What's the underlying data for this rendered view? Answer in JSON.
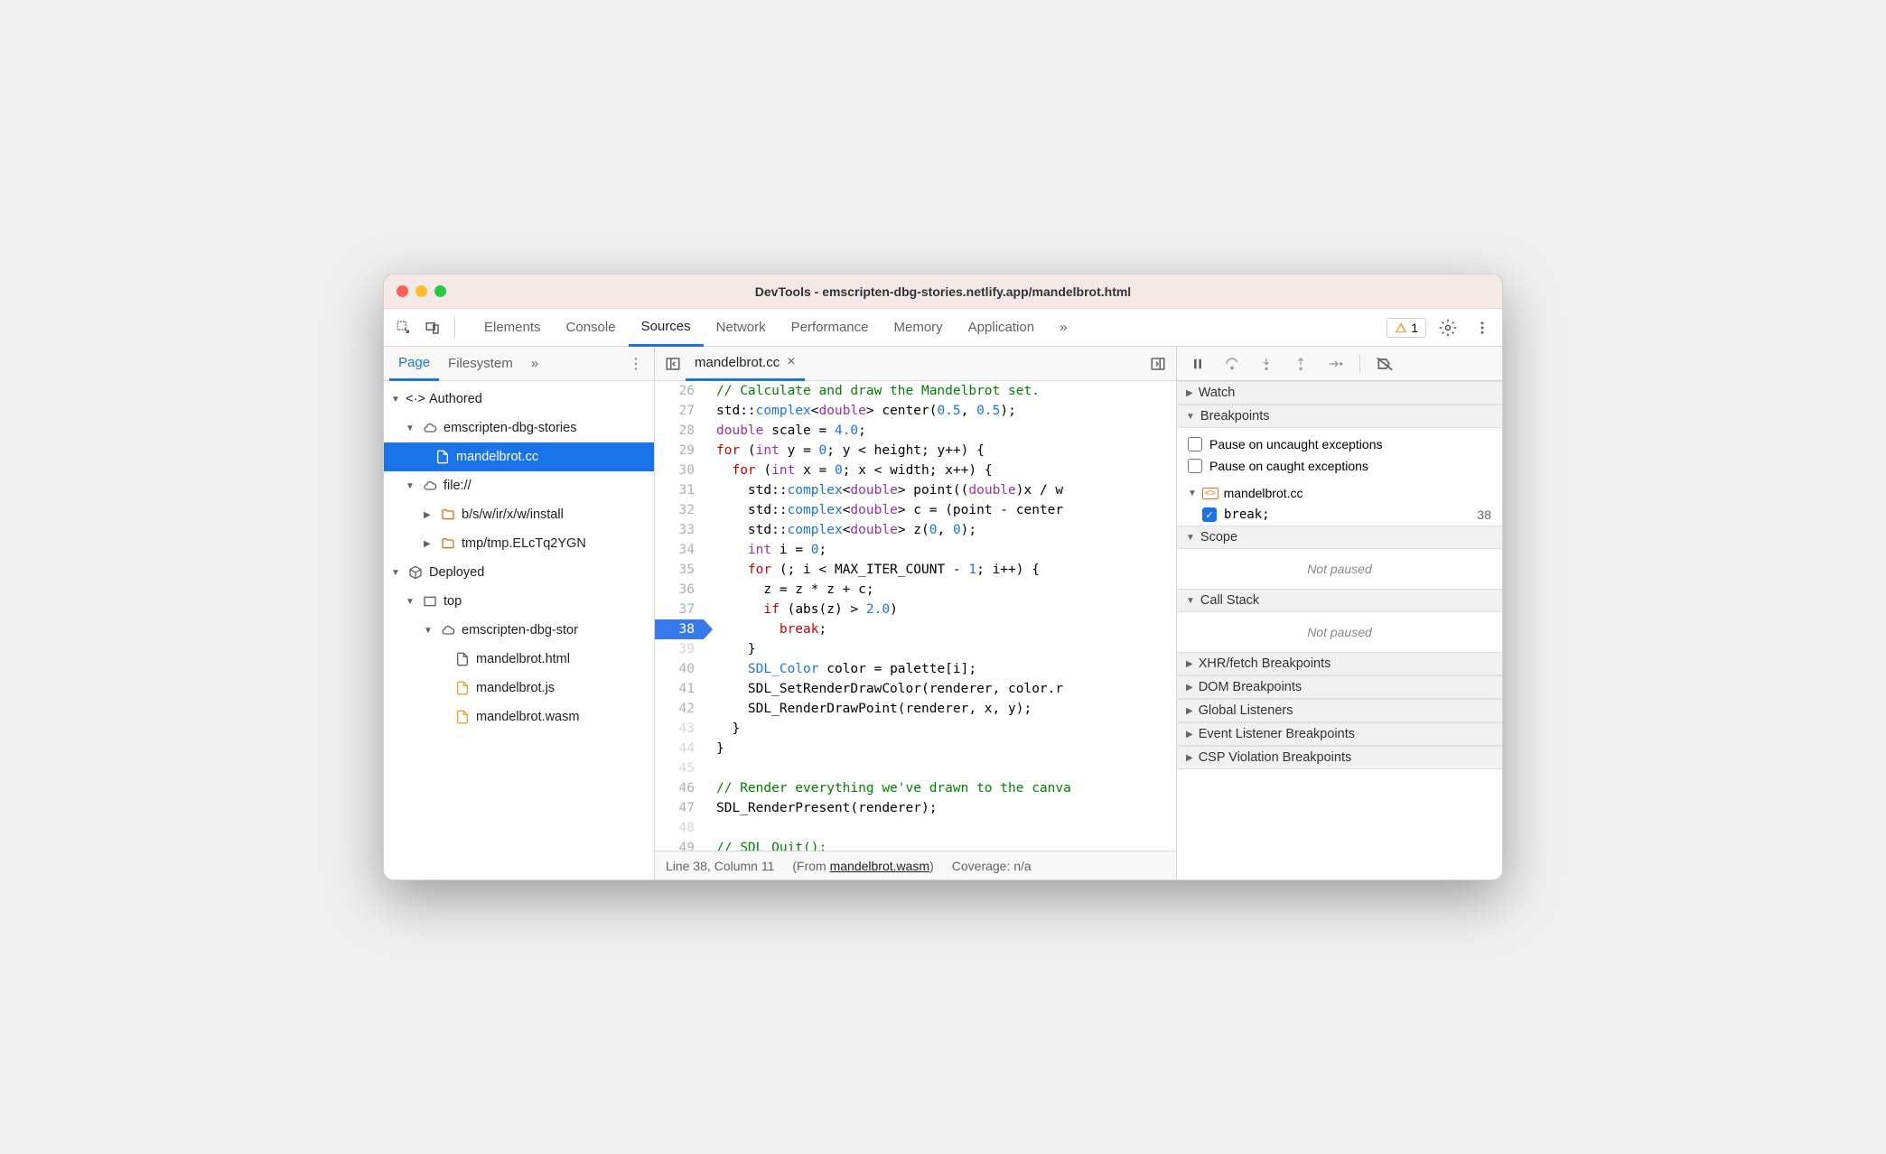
{
  "window": {
    "title": "DevTools - emscripten-dbg-stories.netlify.app/mandelbrot.html"
  },
  "toolbar": {
    "tabs": [
      "Elements",
      "Console",
      "Sources",
      "Network",
      "Performance",
      "Memory",
      "Application"
    ],
    "active_tab": "Sources",
    "warning_count": "1",
    "overflow": "»"
  },
  "sidebar": {
    "tabs": [
      "Page",
      "Filesystem"
    ],
    "active_tab": "Page",
    "overflow": "»",
    "tree": {
      "authored": "Authored",
      "cloud1": "emscripten-dbg-stories",
      "selected_file": "mandelbrot.cc",
      "file_scheme": "file://",
      "folder1": "b/s/w/ir/x/w/install",
      "folder2": "tmp/tmp.ELcTq2YGN",
      "deployed": "Deployed",
      "top": "top",
      "cloud2": "emscripten-dbg-stor",
      "file_html": "mandelbrot.html",
      "file_js": "mandelbrot.js",
      "file_wasm": "mandelbrot.wasm"
    }
  },
  "editor": {
    "open_tab": "mandelbrot.cc",
    "lines": [
      {
        "n": "26",
        "html": "<span class='tok-comment'>// Calculate and draw the Mandelbrot set.</span>"
      },
      {
        "n": "27",
        "html": "std::<span class='tok-type'>complex</span>&lt;<span class='tok-keyword'>double</span>&gt; center(<span class='tok-num'>0.5</span>, <span class='tok-num'>0.5</span>);"
      },
      {
        "n": "28",
        "html": "<span class='tok-keyword'>double</span> scale = <span class='tok-num'>4.0</span>;"
      },
      {
        "n": "29",
        "html": "<span class='tok-kw-red'>for</span> (<span class='tok-keyword'>int</span> y = <span class='tok-num'>0</span>; y &lt; height; y++) {"
      },
      {
        "n": "30",
        "html": "  <span class='tok-kw-red'>for</span> (<span class='tok-keyword'>int</span> x = <span class='tok-num'>0</span>; x &lt; width; x++) {"
      },
      {
        "n": "31",
        "html": "    std::<span class='tok-type'>complex</span>&lt;<span class='tok-keyword'>double</span>&gt; point((<span class='tok-keyword'>double</span>)x / w"
      },
      {
        "n": "32",
        "html": "    std::<span class='tok-type'>complex</span>&lt;<span class='tok-keyword'>double</span>&gt; c = (point - center"
      },
      {
        "n": "33",
        "html": "    std::<span class='tok-type'>complex</span>&lt;<span class='tok-keyword'>double</span>&gt; z(<span class='tok-num'>0</span>, <span class='tok-num'>0</span>);"
      },
      {
        "n": "34",
        "html": "    <span class='tok-keyword'>int</span> i = <span class='tok-num'>0</span>;"
      },
      {
        "n": "35",
        "html": "    <span class='tok-kw-red'>for</span> (; i &lt; MAX_ITER_COUNT - <span class='tok-num'>1</span>; i++) {"
      },
      {
        "n": "36",
        "html": "      z = z * z + c;"
      },
      {
        "n": "37",
        "html": "      <span class='tok-kw-red'>if</span> (abs(z) &gt; <span class='tok-num'>2.0</span>)"
      },
      {
        "n": "38",
        "html": "        <span class='tok-kw-red'>break</span>;",
        "bp": true
      },
      {
        "n": "39",
        "html": "    }",
        "inactive": true
      },
      {
        "n": "40",
        "html": "    <span class='tok-type'>SDL_Color</span> color = palette[i];"
      },
      {
        "n": "41",
        "html": "    SDL_SetRenderDrawColor(renderer, color.r"
      },
      {
        "n": "42",
        "html": "    SDL_RenderDrawPoint(renderer, x, y);"
      },
      {
        "n": "43",
        "html": "  }",
        "inactive": true
      },
      {
        "n": "44",
        "html": "}",
        "inactive": true
      },
      {
        "n": "45",
        "html": "",
        "inactive": true
      },
      {
        "n": "46",
        "html": "<span class='tok-comment'>// Render everything we've drawn to the canva</span>"
      },
      {
        "n": "47",
        "html": "SDL_RenderPresent(renderer);"
      },
      {
        "n": "48",
        "html": "",
        "inactive": true
      },
      {
        "n": "49",
        "html": "<span class='tok-comment'>// SDL_Quit();</span>"
      }
    ],
    "status": {
      "pos": "Line 38, Column 11",
      "from_prefix": "(From ",
      "from_link": "mandelbrot.wasm",
      "from_suffix": ")",
      "coverage": "Coverage: n/a"
    }
  },
  "debug": {
    "sections": {
      "watch": "Watch",
      "breakpoints": "Breakpoints",
      "pause_uncaught": "Pause on uncaught exceptions",
      "pause_caught": "Pause on caught exceptions",
      "bp_file": "mandelbrot.cc",
      "bp_item_text": "break;",
      "bp_item_line": "38",
      "scope": "Scope",
      "not_paused": "Not paused",
      "callstack": "Call Stack",
      "xhr": "XHR/fetch Breakpoints",
      "dom": "DOM Breakpoints",
      "global": "Global Listeners",
      "event": "Event Listener Breakpoints",
      "csp": "CSP Violation Breakpoints"
    }
  }
}
